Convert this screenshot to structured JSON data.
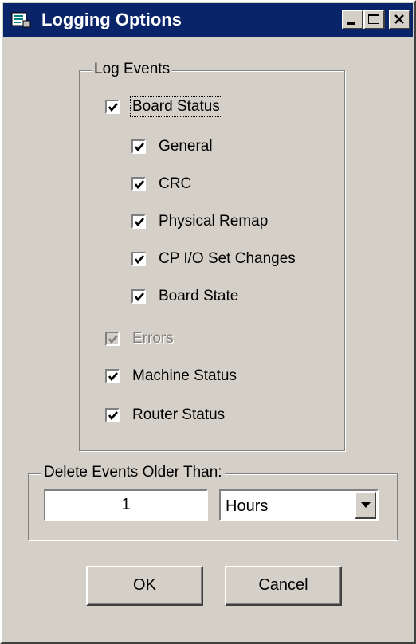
{
  "window": {
    "title": "Logging Options",
    "icon": "log-document-icon",
    "caption_buttons": [
      "minimize-icon",
      "maximize-icon",
      "close-icon"
    ]
  },
  "log_events": {
    "label": "Log Events",
    "items": [
      {
        "label": "Board Status",
        "checked": true,
        "enabled": true,
        "focused": true
      },
      {
        "label": "General",
        "checked": true,
        "enabled": true
      },
      {
        "label": "CRC",
        "checked": true,
        "enabled": true
      },
      {
        "label": "Physical Remap",
        "checked": true,
        "enabled": true
      },
      {
        "label": "CP I/O Set Changes",
        "checked": true,
        "enabled": true
      },
      {
        "label": "Board State",
        "checked": true,
        "enabled": true
      },
      {
        "label": "Errors",
        "checked": true,
        "enabled": false
      },
      {
        "label": "Machine Status",
        "checked": true,
        "enabled": true
      },
      {
        "label": "Router Status",
        "checked": true,
        "enabled": true
      }
    ]
  },
  "delete_events": {
    "label": "Delete Events Older Than:",
    "value": "1",
    "unit": "Hours"
  },
  "buttons": {
    "ok": "OK",
    "cancel": "Cancel"
  },
  "colors": {
    "titlebar": "#0a246a",
    "face": "#d4d0c8"
  }
}
